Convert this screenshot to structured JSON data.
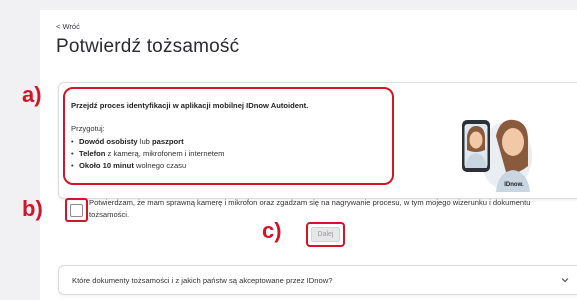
{
  "nav": {
    "back_label": "< Wróć"
  },
  "page": {
    "title": "Potwierdź tożsamość"
  },
  "annotations": {
    "a": "a)",
    "b": "b)",
    "c": "c)",
    "highlight_color": "#d1162b"
  },
  "info": {
    "heading": "Przejdź proces identyfikacji w aplikacji mobilnej IDnow Autoident.",
    "prepare_label": "Przygotuj:",
    "items": [
      {
        "bold": "Dowód osobisty",
        "middle": " lub ",
        "bold2": "paszport",
        "rest": ""
      },
      {
        "bold": "Telefon",
        "middle": " z kamerą, mikrofonem i internetem",
        "bold2": "",
        "rest": ""
      },
      {
        "bold": "Około 10 minut",
        "middle": " wolnego czasu",
        "bold2": "",
        "rest": ""
      }
    ],
    "illustration_icon": "phone-selfie-icon",
    "brand_label": "IDnow."
  },
  "consent": {
    "text": "Potwierdzam, że mam sprawną kamerę i mikrofon oraz zgadzam się na nagrywanie procesu, w tym mojego wizerunku i dokumentu tożsamości.",
    "checked": false
  },
  "next_button": {
    "label": "Dalej",
    "disabled": true
  },
  "faq": {
    "question": "Które dokumenty tożsamości i z jakich państw są akceptowane przez IDnow?"
  }
}
